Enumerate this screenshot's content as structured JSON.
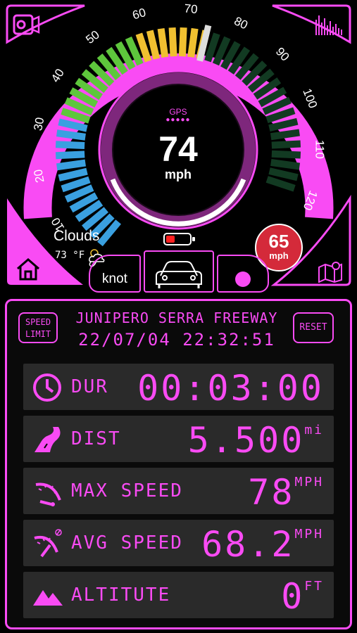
{
  "gauge": {
    "ticks": [
      "0",
      "10",
      "20",
      "30",
      "40",
      "50",
      "60",
      "70",
      "80",
      "90",
      "100",
      "110",
      "120"
    ],
    "source_label": "GPS",
    "speed": "74",
    "speed_value": 74,
    "max_value": 120,
    "unit": "mph"
  },
  "weather": {
    "condition": "Clouds",
    "temperature": "73 °F"
  },
  "speed_limit_badge": {
    "value": "65",
    "unit": "mph"
  },
  "controls": {
    "unit_toggle": "knot"
  },
  "trip": {
    "speed_limit_button": [
      "SPEED",
      "LIMIT"
    ],
    "road": "JUNIPERO SERRA FREEWAY",
    "datetime": "22/07/04 22:32:51",
    "reset_button": "RESET"
  },
  "stats": [
    {
      "label": "DUR",
      "value": "00:03:00",
      "unit": ""
    },
    {
      "label": "DIST",
      "value": "5.500",
      "unit": "mi"
    },
    {
      "label": "MAX SPEED",
      "value": "78",
      "unit": "MPH"
    },
    {
      "label": "AVG SPEED",
      "value": "68.2",
      "unit": "MPH"
    },
    {
      "label": "ALTITUTE",
      "value": "0",
      "unit": "FT"
    }
  ],
  "colors": {
    "accent": "#f94bf4",
    "green": "#5ec63c",
    "blue": "#3aa0e0",
    "yellow": "#f0c030",
    "battery_red": "#ff2020",
    "limit_red": "#d42a3a"
  }
}
